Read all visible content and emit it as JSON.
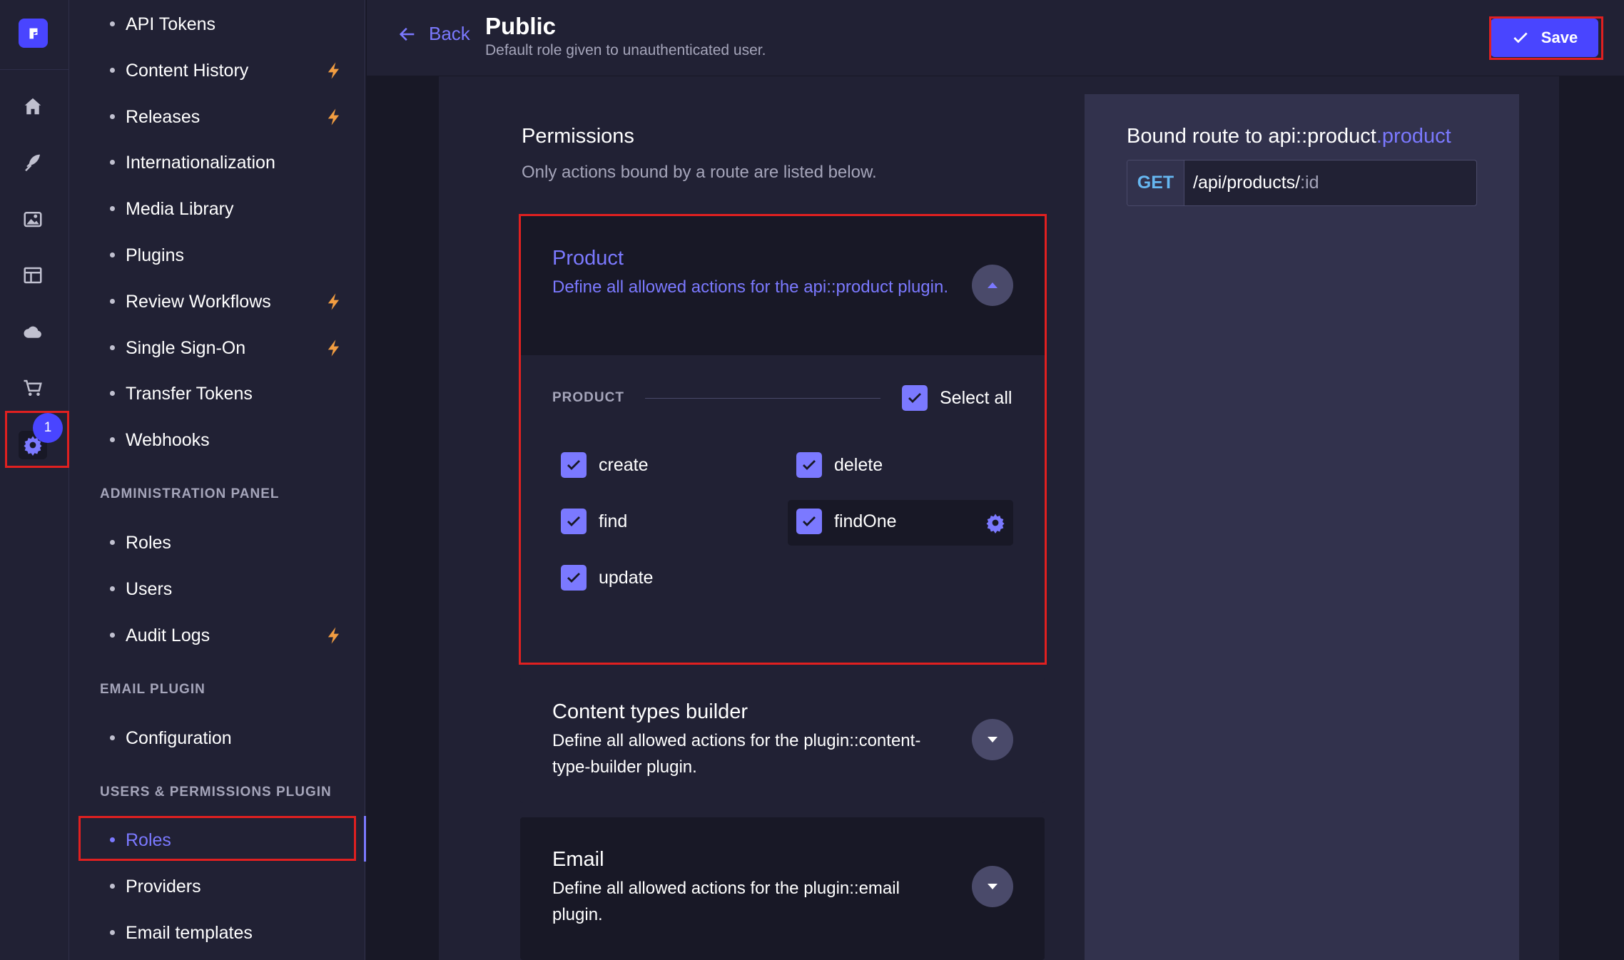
{
  "header": {
    "back_label": "Back",
    "title": "Public",
    "subtitle": "Default role given to unauthenticated user.",
    "save_label": "Save"
  },
  "rail": {
    "badge": "1",
    "icons": [
      "logo-icon",
      "home-icon",
      "feather-icon",
      "media-icon",
      "layout-icon",
      "cloud-icon",
      "cart-icon",
      "gear-icon"
    ]
  },
  "nav": {
    "top_items": [
      {
        "label": "API Tokens",
        "premium": false
      },
      {
        "label": "Content History",
        "premium": true
      },
      {
        "label": "Releases",
        "premium": true
      },
      {
        "label": "Internationalization",
        "premium": false
      },
      {
        "label": "Media Library",
        "premium": false
      },
      {
        "label": "Plugins",
        "premium": false
      },
      {
        "label": "Review Workflows",
        "premium": true
      },
      {
        "label": "Single Sign-On",
        "premium": true
      },
      {
        "label": "Transfer Tokens",
        "premium": false
      },
      {
        "label": "Webhooks",
        "premium": false
      }
    ],
    "admin_section": "ADMINISTRATION PANEL",
    "admin_items": [
      {
        "label": "Roles",
        "premium": false
      },
      {
        "label": "Users",
        "premium": false
      },
      {
        "label": "Audit Logs",
        "premium": true
      }
    ],
    "email_section": "EMAIL PLUGIN",
    "email_items": [
      {
        "label": "Configuration",
        "premium": false
      }
    ],
    "up_section": "USERS & PERMISSIONS PLUGIN",
    "up_items": [
      {
        "label": "Roles",
        "active": true
      },
      {
        "label": "Providers",
        "active": false
      },
      {
        "label": "Email templates",
        "active": false
      }
    ]
  },
  "permissions": {
    "title": "Permissions",
    "subtitle": "Only actions bound by a route are listed below.",
    "product": {
      "title": "Product",
      "description": "Define all allowed actions for the api::product plugin.",
      "section_label": "PRODUCT",
      "select_all_label": "Select all",
      "actions": {
        "create": "create",
        "delete": "delete",
        "find": "find",
        "findOne": "findOne",
        "update": "update"
      }
    },
    "content_types_builder": {
      "title": "Content types builder",
      "description": "Define all allowed actions for the plugin::content-type-builder plugin."
    },
    "email": {
      "title": "Email",
      "description": "Define all allowed actions for the plugin::email plugin."
    }
  },
  "route": {
    "title_prefix": "Bound route to api::product",
    "title_accent": ".product",
    "method": "GET",
    "path": "/api/products/",
    "param": ":id"
  },
  "colors": {
    "accent": "#7b79ff",
    "primary": "#4945ff",
    "premium": "#f29d41",
    "highlight": "#e02020",
    "get_method": "#66b7f1"
  }
}
